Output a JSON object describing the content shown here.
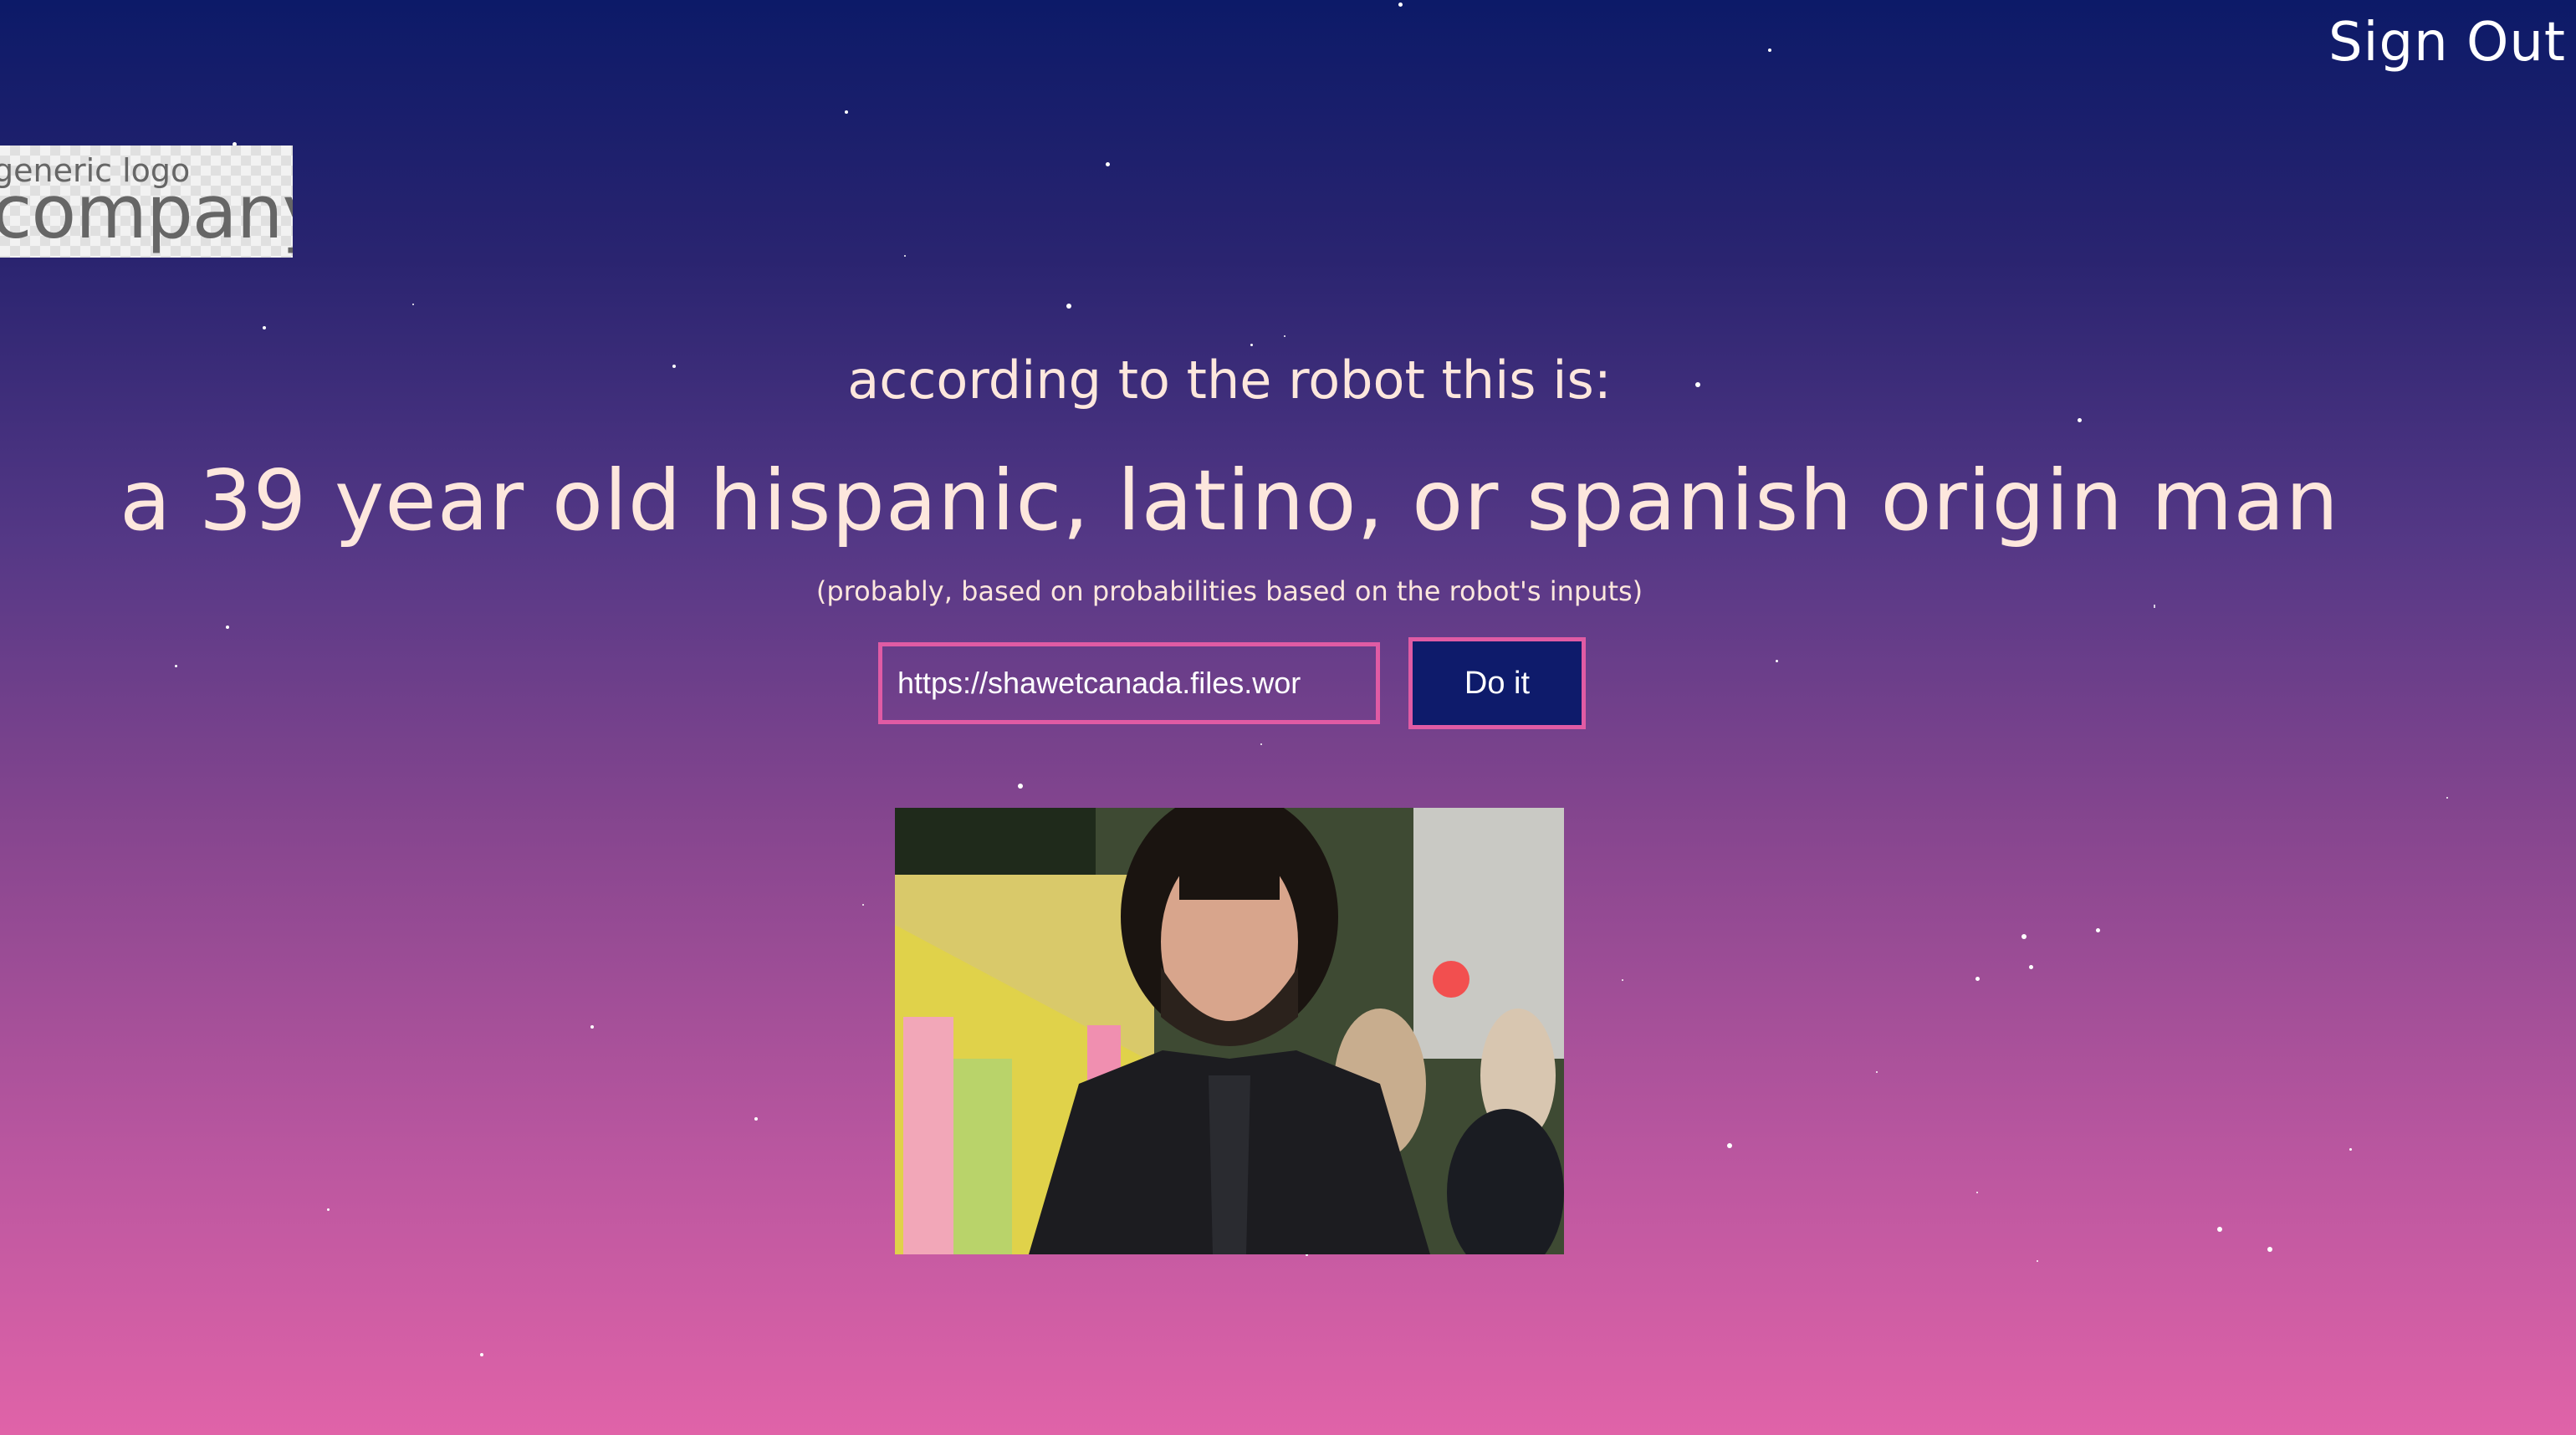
{
  "header": {
    "sign_out_label": "Sign Out"
  },
  "logo": {
    "tagline": "generic logo",
    "name": "company"
  },
  "main": {
    "subtitle": "according to the robot this is:",
    "result": "a 39 year old hispanic, latino, or spanish origin man",
    "note": "(probably, based on probabilities based on the robot's inputs)"
  },
  "form": {
    "url_value": "https://shawetcanada.files.wor",
    "submit_label": "Do it"
  },
  "colors": {
    "accent_border": "#e05ba4",
    "button_bg": "#0e1b6b",
    "text": "#fde7dd"
  }
}
